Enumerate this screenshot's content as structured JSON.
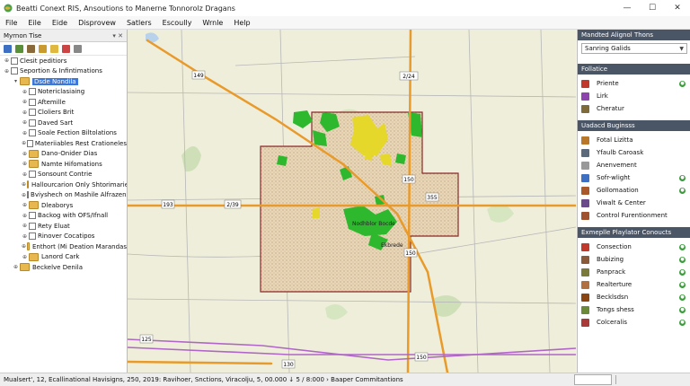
{
  "window": {
    "title": "Beatti Conext RIS, Ansoutions to Manerne Tonnorolz Dragans",
    "minimize": "—",
    "maximize": "☐",
    "close": "✕"
  },
  "menu": [
    "File",
    "Eile",
    "Eide",
    "Disprovew",
    "Satlers",
    "Escoully",
    "Wrnle",
    "Help"
  ],
  "left_panel": {
    "title": "Myrnon Tise",
    "pin": "▾ ✕",
    "tree": [
      {
        "label": "Clesit peditiors",
        "indent": 0,
        "twisty": "⊕",
        "type": "check"
      },
      {
        "label": "Seportion & Infintimations",
        "indent": 0,
        "twisty": "⊕",
        "type": "check"
      },
      {
        "label": "Dsde Nondila",
        "indent": 1,
        "twisty": "▾",
        "type": "folder",
        "selected": true
      },
      {
        "label": "Notericlasiaing",
        "indent": 2,
        "twisty": "⊕",
        "type": "check"
      },
      {
        "label": "Aftemille",
        "indent": 2,
        "twisty": "⊕",
        "type": "check"
      },
      {
        "label": "Cloliers Brit",
        "indent": 2,
        "twisty": "⊕",
        "type": "check"
      },
      {
        "label": "Daved Sart",
        "indent": 2,
        "twisty": "⊕",
        "type": "check"
      },
      {
        "label": "Soale Fection Biltolations",
        "indent": 2,
        "twisty": "⊕",
        "type": "check"
      },
      {
        "label": "Materiiables Rest Crationeles",
        "indent": 2,
        "twisty": "⊕",
        "type": "check"
      },
      {
        "label": "Dano-Onider Dias",
        "indent": 2,
        "twisty": "⊕",
        "type": "folder"
      },
      {
        "label": "Namte Hifomations",
        "indent": 2,
        "twisty": "⊕",
        "type": "folder"
      },
      {
        "label": "Sonsount Contrie",
        "indent": 2,
        "twisty": "⊕",
        "type": "check"
      },
      {
        "label": "Hallourcarion Only Shtorimariet",
        "indent": 2,
        "twisty": "⊕",
        "type": "folder"
      },
      {
        "label": "Bviyshech on Mashile Alfrazens",
        "indent": 2,
        "twisty": "⊕",
        "type": "check"
      },
      {
        "label": "Dleaborys",
        "indent": 2,
        "twisty": "⊕",
        "type": "folder"
      },
      {
        "label": "Backog with OFS/Ifnall",
        "indent": 2,
        "twisty": "⊕",
        "type": "check"
      },
      {
        "label": "Rety Eluat",
        "indent": 2,
        "twisty": "⊕",
        "type": "check"
      },
      {
        "label": "Rinover Cocatipos",
        "indent": 2,
        "twisty": "⊕",
        "type": "check"
      },
      {
        "label": "Enthort (Mi Deation Marandas",
        "indent": 2,
        "twisty": "⊕",
        "type": "folder"
      },
      {
        "label": "Lanord Cark",
        "indent": 2,
        "twisty": "⊕",
        "type": "folder"
      },
      {
        "label": "Beckelve Denila",
        "indent": 1,
        "twisty": "⊕",
        "type": "folder"
      }
    ]
  },
  "map": {
    "road_labels": [
      "149",
      "2/24",
      "150",
      "355",
      "193",
      "2/39",
      "150",
      "125",
      "130",
      "150"
    ],
    "place_labels": [
      "Nodhblor Bocde",
      "Ekbrede"
    ]
  },
  "right_panel": {
    "sections": [
      {
        "title": "Mandted Alignol Thons",
        "dropdown": "Sanring Galids",
        "items": []
      },
      {
        "title": "Follatice",
        "items": [
          {
            "label": "Priente",
            "dot": "●"
          },
          {
            "label": "Lirk",
            "dot": ""
          },
          {
            "label": "Cheratur",
            "dot": ""
          }
        ]
      },
      {
        "title": "Uadacd Buginsss",
        "items": [
          {
            "label": "Fotal Lizitta",
            "dot": ""
          },
          {
            "label": "Yfaulb Caroask",
            "dot": ""
          },
          {
            "label": "Anenvement",
            "dot": ""
          },
          {
            "label": "Sofr-wlight",
            "dot": "●"
          },
          {
            "label": "Gollomaation",
            "dot": "●"
          },
          {
            "label": "Viwalt & Center",
            "dot": ""
          },
          {
            "label": "Control Furentionment",
            "dot": ""
          }
        ]
      },
      {
        "title": "Exmeplle Playlator Conoucts",
        "items": [
          {
            "label": "Consection",
            "dot": "●"
          },
          {
            "label": "Bubizing",
            "dot": "●"
          },
          {
            "label": "Panprack",
            "dot": "●"
          },
          {
            "label": "Realterture",
            "dot": "●"
          },
          {
            "label": "Becklsdsn",
            "dot": "●"
          },
          {
            "label": "Tongs shess",
            "dot": "●"
          },
          {
            "label": "Colceralis",
            "dot": "●"
          }
        ]
      }
    ]
  },
  "status": {
    "text": "Mualsert', 12, Ecallinational Havisigns, 250, 2019: Ravihoer, Snctions, Viracolju, 5, 00.000 ↓ 5 / 8:000 › Baaper Commitantions"
  }
}
